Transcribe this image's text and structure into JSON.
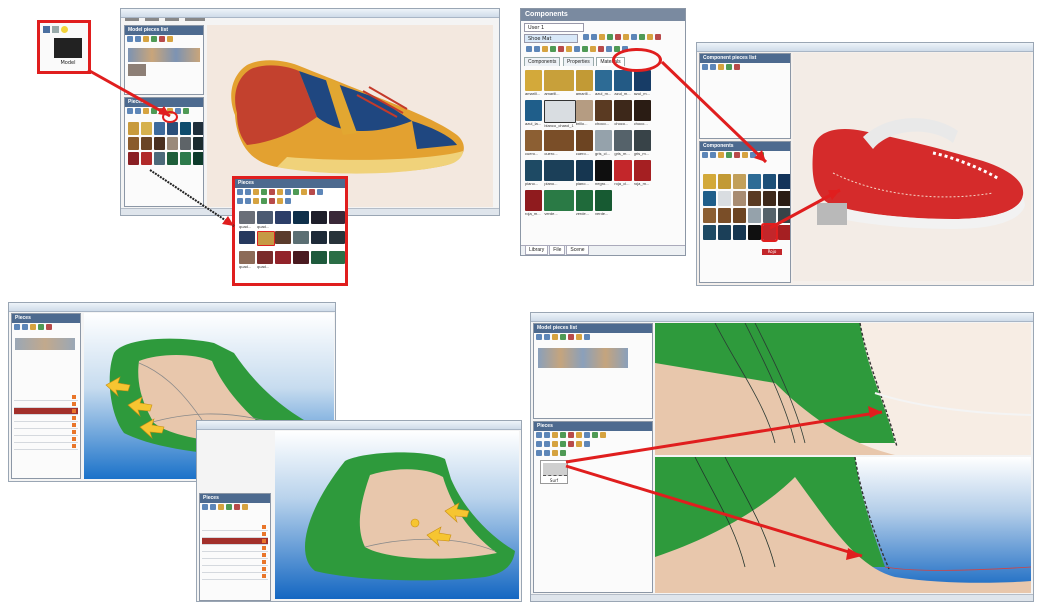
{
  "q1": {
    "picker_caption": "Model",
    "panels": {
      "model_pieces": "Model pieces list",
      "pieces": "Pieces"
    },
    "zoom_items": [
      "quad...",
      "quad...",
      "quad...",
      "quad..."
    ]
  },
  "q2": {
    "components_title": "Components",
    "user_select": "User 1",
    "type_select": "Shoe Mat",
    "tabs": {
      "components": "Components",
      "properties": "Properties",
      "materials": "Materials"
    },
    "swatches": [
      "amarill...",
      "amarill...",
      "amarill...",
      "azul_m...",
      "azul_m...",
      "azul_m...",
      "azul_la...",
      "blanco_charol_1",
      "brillo...",
      "choco...",
      "choco...",
      "choco...",
      "cuero...",
      "cuero...",
      "cuero...",
      "gris_cl...",
      "gris_m...",
      "gris_m...",
      "piano...",
      "piano...",
      "piano...",
      "negro...",
      "roja_cl...",
      "roja_m...",
      "roja_m...",
      "verde...",
      "verde...",
      "verde..."
    ],
    "bottom_tabs": [
      "Library",
      "File",
      "Scene"
    ],
    "small_panels": {
      "component_pieces": "Component pieces list",
      "components": "Components"
    },
    "selected_swatch": "Rojo"
  },
  "q3": {
    "panel_title": "Pieces"
  },
  "q4": {
    "panels": {
      "model_pieces": "Model pieces list",
      "pieces": "Pieces"
    },
    "piece_caption": "Surf"
  },
  "colors": {
    "highlight": "#e01e1e",
    "arrow_yellow": "#f6c531",
    "shoe_green": "#2e9a3c",
    "shoe_skin": "#e8c7ac"
  }
}
